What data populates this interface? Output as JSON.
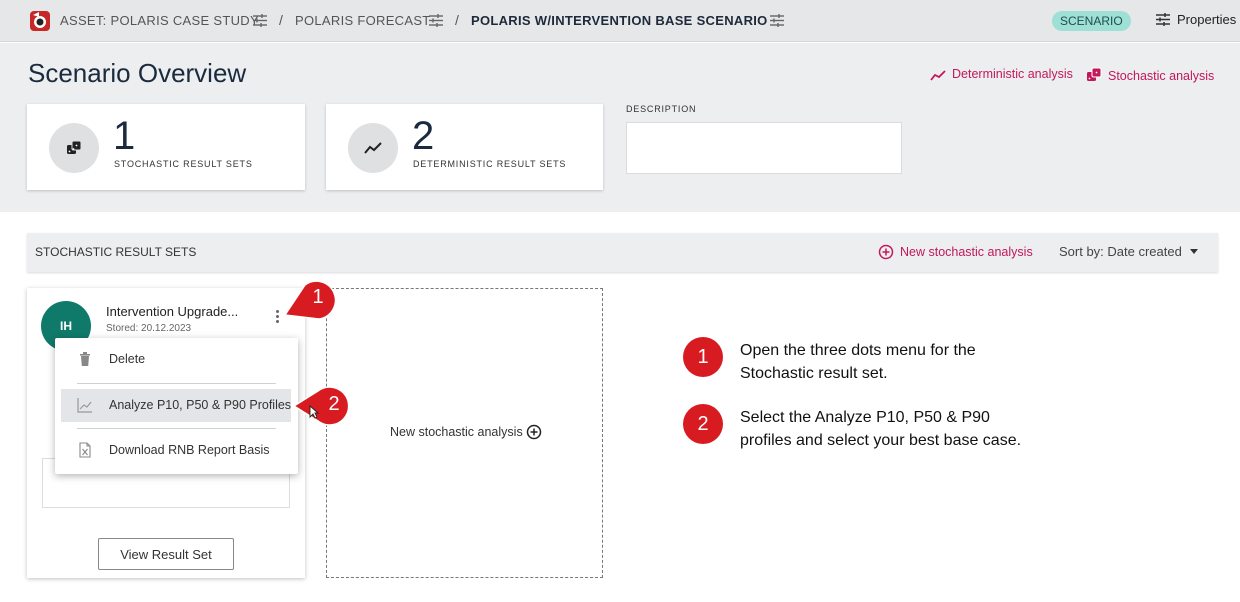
{
  "breadcrumb": {
    "items": [
      "ASSET: POLARIS CASE STUDY",
      "POLARIS FORECAST",
      "POLARIS W/INTERVENTION BASE SCENARIO"
    ],
    "separator": "/"
  },
  "topbar": {
    "badge": "SCENARIO",
    "properties_label": "Properties"
  },
  "page": {
    "title": "Scenario Overview",
    "deterministic_link": "Deterministic analysis",
    "stochastic_link": "Stochastic analysis"
  },
  "stats": [
    {
      "value": "1",
      "label": "STOCHASTIC RESULT SETS",
      "icon": "dice-icon"
    },
    {
      "value": "2",
      "label": "DETERMINISTIC RESULT SETS",
      "icon": "trend-line-icon"
    }
  ],
  "description": {
    "label": "DESCRIPTION",
    "value": ""
  },
  "section": {
    "title": "STOCHASTIC RESULT SETS",
    "new_link": "New stochastic analysis",
    "sort_label": "Sort by: Date created"
  },
  "result_set": {
    "avatar": "IH",
    "title": "Intervention Upgrade...",
    "stored": "Stored: 20.12.2023",
    "view_button": "View Result Set"
  },
  "new_card": {
    "label": "New stochastic analysis"
  },
  "menu": {
    "items": [
      {
        "label": "Delete",
        "icon": "trash-icon"
      },
      {
        "label": "Analyze P10, P50 & P90 Profiles",
        "icon": "chart-line-icon"
      },
      {
        "label": "Download RNB Report Basis",
        "icon": "excel-file-icon"
      }
    ]
  },
  "callouts": {
    "step1": "1",
    "step2": "2"
  },
  "instructions": [
    {
      "num": "1",
      "line1": "Open the three dots menu for the",
      "line2": "Stochastic result set."
    },
    {
      "num": "2",
      "line1": "Select the Analyze P10, P50 & P90",
      "line2": "profiles and select your best base case."
    }
  ],
  "colors": {
    "accent": "#c2185b",
    "callout_red": "#d81b20",
    "avatar_teal": "#0f7a6a",
    "badge_bg": "#9ee0d6"
  }
}
